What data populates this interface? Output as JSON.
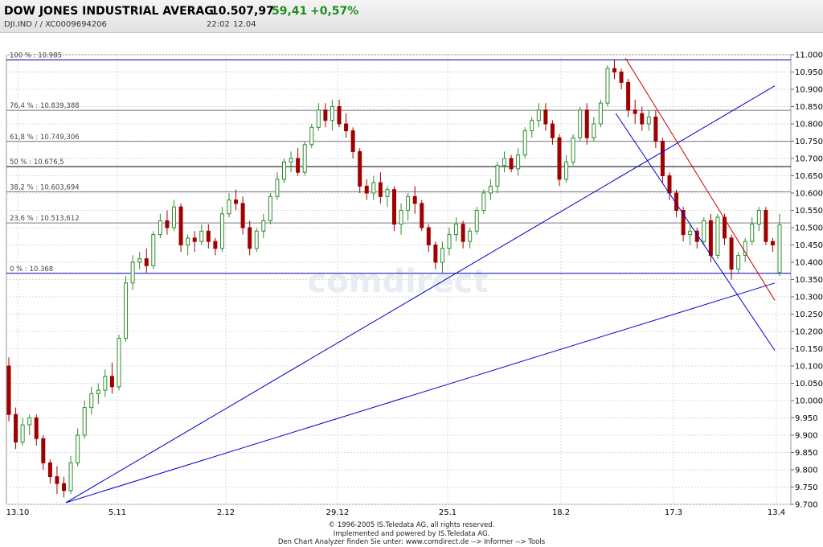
{
  "header": {
    "title": "DOW JONES INDUSTRIAL AVERAG",
    "price": "10.507,97",
    "change": "59,41",
    "change_pct": "+0,57%",
    "symbol_line": "DJI.IND  /     / XC0009694206",
    "time": "22:02",
    "date": "12.04"
  },
  "footer": {
    "line1": "© 1996-2005 IS.Teledata AG, all rights reserved.",
    "line2": "Implemented and powered by IS.Teledata AG.",
    "line3": "Den Chart Analyzer finden Sie unter: www.comdirect.de --> Informer --> Tools"
  },
  "watermark": "comdirect",
  "colors": {
    "up": "#2e8b2e",
    "down": "#a00000",
    "trend": "#0000cc",
    "resistance": "#cc0000",
    "change": "#1a8f1a"
  },
  "chart_data": {
    "type": "candlestick",
    "ylim": [
      9700,
      11000
    ],
    "y_ticks": [
      "11.000",
      "10.950",
      "10.900",
      "10.850",
      "10.800",
      "10.750",
      "10.700",
      "10.650",
      "10.600",
      "10.550",
      "10.500",
      "10.450",
      "10.400",
      "10.350",
      "10.300",
      "10.250",
      "10.200",
      "10.150",
      "10.100",
      "10.050",
      "10.000",
      "9.950",
      "9.900",
      "9.850",
      "9.800",
      "9.750",
      "9.700"
    ],
    "x_ticks": [
      "13.10",
      "5.11",
      "2.12",
      "29.12",
      "25.1",
      "18.2",
      "17.3",
      "13.4"
    ],
    "fibonacci_levels": [
      {
        "label": "100 % : 10.985",
        "value": 10985
      },
      {
        "label": "76,4 % : 10.839,388",
        "value": 10839.388
      },
      {
        "label": "61,8 % : 10.749,306",
        "value": 10749.306
      },
      {
        "label": "50 % : 10.676,5",
        "value": 10676.5
      },
      {
        "label": "38,2 % : 10.603,694",
        "value": 10603.694
      },
      {
        "label": "23,6 % : 10.513,612",
        "value": 10513.612
      },
      {
        "label": "0 % : 10.368",
        "value": 10368
      }
    ],
    "series": [
      {
        "values": [
          [
            10100,
            10125,
            9940,
            9960
          ],
          [
            9960,
            9980,
            9860,
            9880
          ],
          [
            9880,
            9950,
            9870,
            9930
          ],
          [
            9930,
            9960,
            9900,
            9950
          ],
          [
            9950,
            9960,
            9870,
            9890
          ],
          [
            9890,
            9900,
            9800,
            9820
          ],
          [
            9820,
            9830,
            9760,
            9780
          ],
          [
            9780,
            9810,
            9730,
            9760
          ],
          [
            9760,
            9780,
            9720,
            9740
          ],
          [
            9740,
            9840,
            9730,
            9820
          ],
          [
            9820,
            9920,
            9810,
            9900
          ],
          [
            9900,
            10000,
            9890,
            9980
          ],
          [
            9980,
            10040,
            9960,
            10020
          ],
          [
            10020,
            10050,
            9990,
            10030
          ],
          [
            10030,
            10090,
            10010,
            10070
          ],
          [
            10070,
            10110,
            10020,
            10040
          ],
          [
            10040,
            10190,
            10030,
            10180
          ],
          [
            10180,
            10360,
            10170,
            10340
          ],
          [
            10340,
            10420,
            10320,
            10400
          ],
          [
            10400,
            10430,
            10380,
            10410
          ],
          [
            10410,
            10440,
            10370,
            10390
          ],
          [
            10390,
            10490,
            10380,
            10480
          ],
          [
            10480,
            10540,
            10470,
            10520
          ],
          [
            10520,
            10550,
            10480,
            10500
          ],
          [
            10500,
            10580,
            10490,
            10560
          ],
          [
            10560,
            10570,
            10430,
            10450
          ],
          [
            10450,
            10480,
            10420,
            10470
          ],
          [
            10470,
            10490,
            10430,
            10460
          ],
          [
            10460,
            10510,
            10450,
            10490
          ],
          [
            10490,
            10510,
            10440,
            10460
          ],
          [
            10460,
            10470,
            10420,
            10440
          ],
          [
            10440,
            10560,
            10430,
            10540
          ],
          [
            10540,
            10600,
            10530,
            10580
          ],
          [
            10580,
            10610,
            10550,
            10570
          ],
          [
            10570,
            10590,
            10480,
            10500
          ],
          [
            10500,
            10520,
            10420,
            10440
          ],
          [
            10440,
            10500,
            10430,
            10490
          ],
          [
            10490,
            10540,
            10470,
            10520
          ],
          [
            10520,
            10600,
            10510,
            10590
          ],
          [
            10590,
            10660,
            10580,
            10640
          ],
          [
            10640,
            10700,
            10630,
            10690
          ],
          [
            10690,
            10720,
            10660,
            10700
          ],
          [
            10700,
            10730,
            10650,
            10660
          ],
          [
            10660,
            10750,
            10650,
            10740
          ],
          [
            10740,
            10800,
            10730,
            10790
          ],
          [
            10790,
            10860,
            10780,
            10840
          ],
          [
            10840,
            10860,
            10790,
            10810
          ],
          [
            10810,
            10870,
            10780,
            10850
          ],
          [
            10850,
            10870,
            10790,
            10800
          ],
          [
            10800,
            10830,
            10760,
            10780
          ],
          [
            10780,
            10790,
            10700,
            10720
          ],
          [
            10720,
            10730,
            10600,
            10620
          ],
          [
            10620,
            10640,
            10580,
            10600
          ],
          [
            10600,
            10650,
            10580,
            10630
          ],
          [
            10630,
            10660,
            10570,
            10590
          ],
          [
            10590,
            10620,
            10560,
            10610
          ],
          [
            10610,
            10620,
            10490,
            10510
          ],
          [
            10510,
            10570,
            10480,
            10550
          ],
          [
            10550,
            10600,
            10520,
            10590
          ],
          [
            10590,
            10620,
            10540,
            10570
          ],
          [
            10570,
            10580,
            10490,
            10500
          ],
          [
            10500,
            10510,
            10430,
            10450
          ],
          [
            10450,
            10460,
            10380,
            10400
          ],
          [
            10400,
            10460,
            10370,
            10440
          ],
          [
            10440,
            10500,
            10420,
            10480
          ],
          [
            10480,
            10530,
            10460,
            10510
          ],
          [
            10510,
            10520,
            10440,
            10460
          ],
          [
            10460,
            10500,
            10440,
            10490
          ],
          [
            10490,
            10560,
            10480,
            10550
          ],
          [
            10550,
            10610,
            10540,
            10600
          ],
          [
            10600,
            10640,
            10580,
            10620
          ],
          [
            10620,
            10690,
            10600,
            10680
          ],
          [
            10680,
            10720,
            10660,
            10700
          ],
          [
            10700,
            10710,
            10660,
            10670
          ],
          [
            10670,
            10730,
            10650,
            10710
          ],
          [
            10710,
            10790,
            10700,
            10780
          ],
          [
            10780,
            10820,
            10760,
            10810
          ],
          [
            10810,
            10860,
            10790,
            10840
          ],
          [
            10840,
            10860,
            10780,
            10800
          ],
          [
            10800,
            10810,
            10740,
            10760
          ],
          [
            10760,
            10770,
            10620,
            10640
          ],
          [
            10640,
            10710,
            10630,
            10690
          ],
          [
            10690,
            10770,
            10680,
            10760
          ],
          [
            10760,
            10850,
            10750,
            10840
          ],
          [
            10840,
            10860,
            10740,
            10760
          ],
          [
            10760,
            10820,
            10750,
            10800
          ],
          [
            10800,
            10870,
            10790,
            10860
          ],
          [
            10860,
            10970,
            10850,
            10960
          ],
          [
            10960,
            10985,
            10930,
            10950
          ],
          [
            10950,
            10960,
            10900,
            10920
          ],
          [
            10920,
            10930,
            10820,
            10840
          ],
          [
            10840,
            10870,
            10800,
            10830
          ],
          [
            10830,
            10850,
            10780,
            10800
          ],
          [
            10800,
            10840,
            10780,
            10820
          ],
          [
            10820,
            10840,
            10730,
            10750
          ],
          [
            10750,
            10760,
            10630,
            10650
          ],
          [
            10650,
            10660,
            10580,
            10600
          ],
          [
            10600,
            10610,
            10530,
            10550
          ],
          [
            10550,
            10560,
            10460,
            10480
          ],
          [
            10480,
            10510,
            10450,
            10490
          ],
          [
            10490,
            10500,
            10440,
            10460
          ],
          [
            10460,
            10530,
            10450,
            10520
          ],
          [
            10520,
            10540,
            10400,
            10420
          ],
          [
            10420,
            10540,
            10410,
            10530
          ],
          [
            10530,
            10540,
            10450,
            10470
          ],
          [
            10470,
            10480,
            10350,
            10380
          ],
          [
            10380,
            10430,
            10370,
            10420
          ],
          [
            10420,
            10470,
            10400,
            10460
          ],
          [
            10460,
            10530,
            10450,
            10510
          ],
          [
            10510,
            10560,
            10490,
            10550
          ],
          [
            10550,
            10560,
            10450,
            10460
          ],
          [
            10460,
            10470,
            10430,
            10450
          ],
          [
            10370,
            10540,
            10360,
            10508
          ]
        ]
      }
    ]
  }
}
